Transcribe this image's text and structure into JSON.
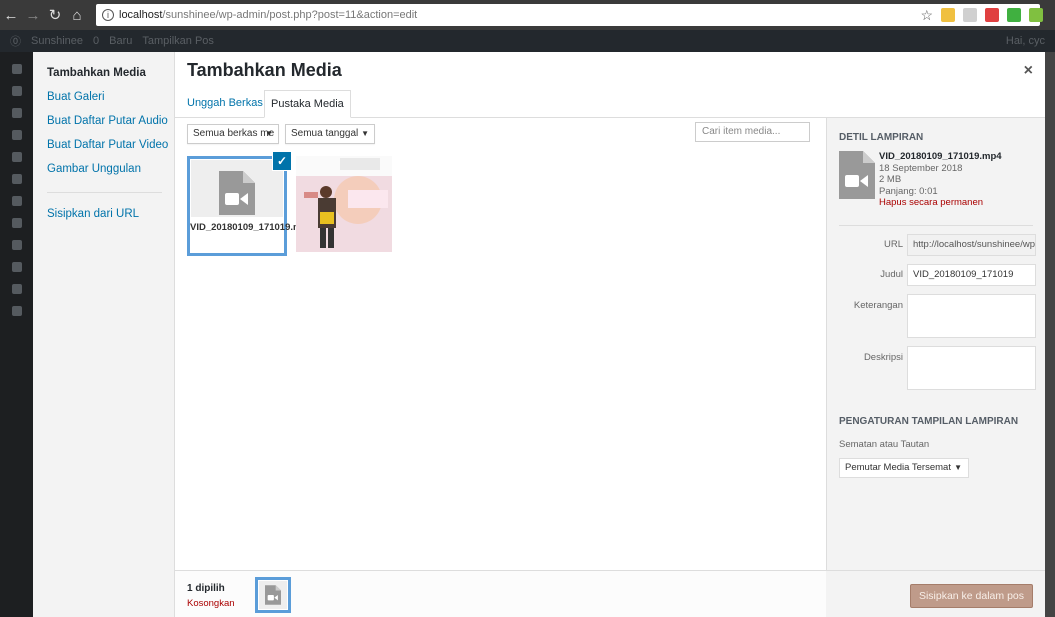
{
  "browser": {
    "url_host": "localhost",
    "url_path": "/sunshinee/wp-admin/post.php?post=11&action=edit"
  },
  "adminbar": {
    "site": "Sunshinee",
    "comments": "0",
    "new": "Baru",
    "view": "Tampilkan Pos",
    "greeting": "Hai, cyc"
  },
  "menu": {
    "items": [
      {
        "label": "Tambahkan Media"
      },
      {
        "label": "Buat Galeri"
      },
      {
        "label": "Buat Daftar Putar Audio"
      },
      {
        "label": "Buat Daftar Putar Video"
      },
      {
        "label": "Gambar Unggulan"
      },
      {
        "label": "Sisipkan dari URL"
      }
    ]
  },
  "modal": {
    "title": "Tambahkan Media",
    "close": "×",
    "tabs": [
      {
        "label": "Unggah Berkas"
      },
      {
        "label": "Pustaka Media"
      }
    ]
  },
  "toolbar": {
    "filter_type": "Semua berkas me",
    "filter_date": "Semua tanggal",
    "search_placeholder": "Cari item media..."
  },
  "library": {
    "video_name": "VID_20180109_171019.mp4",
    "photo_text": "INDONESIA CORPORATE PR AWARD 2018",
    "photo_banner": "IPRA",
    "check": "✓"
  },
  "details": {
    "heading": "Detil Lampiran",
    "filename": "VID_20180109_171019.mp4",
    "date": "18 September 2018",
    "size": "2 MB",
    "length": "Panjang: 0:01",
    "delete": "Hapus secara permanen",
    "fields": {
      "url_label": "URL",
      "url_value": "http://localhost/sunshinee/wp",
      "title_label": "Judul",
      "title_value": "VID_20180109_171019",
      "caption_label": "Keterangan",
      "caption_value": "",
      "desc_label": "Deskripsi",
      "desc_value": ""
    },
    "display_heading": "Pengaturan Tampilan Lampiran",
    "embed_label": "Sematan atau Tautan",
    "embed_value": "Pemutar Media Tersemat"
  },
  "footer": {
    "selected": "1 dipilih",
    "clear": "Kosongkan",
    "insert": "Sisipkan ke dalam pos"
  },
  "colors": {
    "accent": "#0073aa",
    "selected_border": "#5b9dd9",
    "danger": "#a00000",
    "insert_button": "#bf9b8a"
  }
}
